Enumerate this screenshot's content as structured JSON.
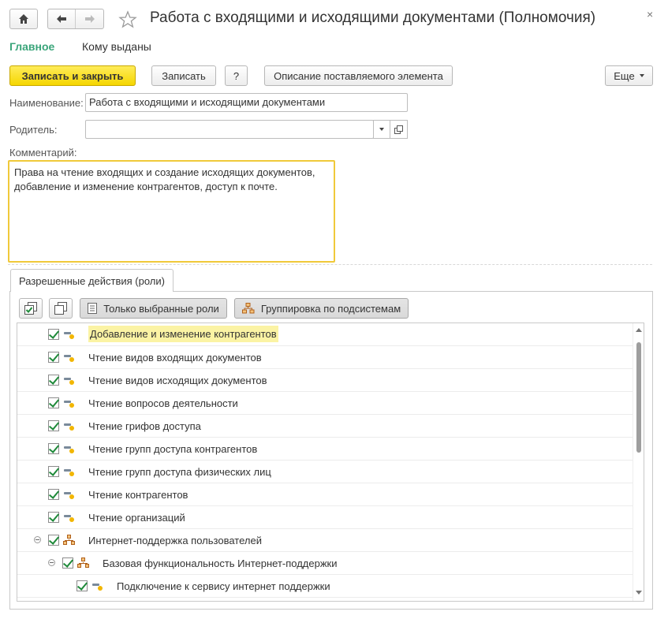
{
  "window": {
    "title": "Работа с входящими и исходящими документами (Полномочия)",
    "close_glyph": "×"
  },
  "nav": {
    "main_link": "Главное",
    "issued_to_link": "Кому выданы"
  },
  "toolbar": {
    "save_close": "Записать и закрыть",
    "save": "Записать",
    "help": "?",
    "description": "Описание поставляемого элемента",
    "more": "Еще"
  },
  "form": {
    "name_label": "Наименование:",
    "name_value": "Работа с входящими и исходящими документами",
    "parent_label": "Родитель:",
    "parent_value": "",
    "comment_label": "Комментарий:",
    "comment_value": "Права на чтение входящих и создание исходящих документов, добавление и изменение контрагентов, доступ к почте."
  },
  "tabs": {
    "roles_tab": "Разрешенные действия (роли)"
  },
  "roles_toolbar": {
    "selected_only": "Только выбранные роли",
    "grouping": "Группировка по подсистемам"
  },
  "roles": [
    {
      "label": "Добавление и изменение контрагентов",
      "checked": true,
      "type": "role",
      "level": 0,
      "selected": true
    },
    {
      "label": "Чтение видов входящих документов",
      "checked": true,
      "type": "role",
      "level": 0
    },
    {
      "label": "Чтение видов исходящих документов",
      "checked": true,
      "type": "role",
      "level": 0
    },
    {
      "label": "Чтение вопросов деятельности",
      "checked": true,
      "type": "role",
      "level": 0
    },
    {
      "label": "Чтение грифов доступа",
      "checked": true,
      "type": "role",
      "level": 0
    },
    {
      "label": "Чтение групп доступа контрагентов",
      "checked": true,
      "type": "role",
      "level": 0
    },
    {
      "label": "Чтение групп доступа физических лиц",
      "checked": true,
      "type": "role",
      "level": 0
    },
    {
      "label": "Чтение контрагентов",
      "checked": true,
      "type": "role",
      "level": 0
    },
    {
      "label": "Чтение организаций",
      "checked": true,
      "type": "role",
      "level": 0
    },
    {
      "label": "Интернет-поддержка пользователей",
      "checked": true,
      "type": "subsystem",
      "level": 0,
      "expanded": true
    },
    {
      "label": "Базовая функциональность Интернет-поддержки",
      "checked": true,
      "type": "subsystem",
      "level": 1,
      "expanded": true
    },
    {
      "label": "Подключение к сервису интернет поддержки",
      "checked": true,
      "type": "role",
      "level": 2
    }
  ],
  "colors": {
    "accent_green": "#3aa57a",
    "primary_button": "#f5d600",
    "comment_border": "#f0c93a",
    "check_green": "#1f8a3a"
  }
}
